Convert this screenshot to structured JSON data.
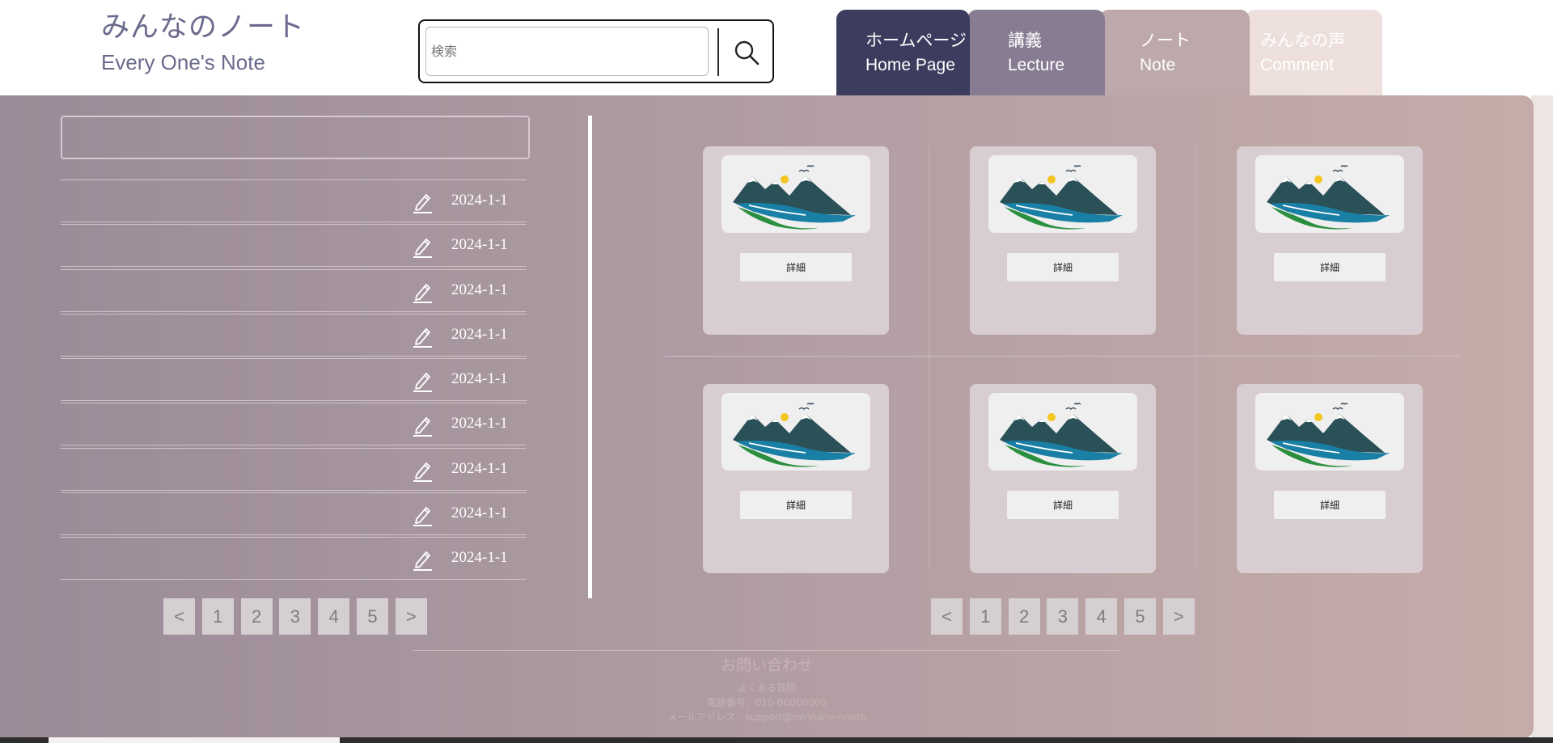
{
  "header": {
    "logo_jp": "みんなのノート",
    "logo_en": "Every One's Note",
    "search_placeholder": "検索",
    "search_icon": "magnifier-icon"
  },
  "nav": {
    "tabs": [
      {
        "jp": "ホームページ",
        "en": "Home Page"
      },
      {
        "jp": "講義",
        "en": "Lecture"
      },
      {
        "jp": "ノート",
        "en": "Note"
      },
      {
        "jp": "みんなの声",
        "en": "Comment"
      }
    ],
    "active": "Note"
  },
  "left_list": {
    "edit_icon": "pencil-icon",
    "items": [
      {
        "date": "2024-1-1"
      },
      {
        "date": "2024-1-1"
      },
      {
        "date": "2024-1-1"
      },
      {
        "date": "2024-1-1"
      },
      {
        "date": "2024-1-1"
      },
      {
        "date": "2024-1-1"
      },
      {
        "date": "2024-1-1"
      },
      {
        "date": "2024-1-1"
      },
      {
        "date": "2024-1-1"
      }
    ],
    "pagination": [
      "<",
      "1",
      "2",
      "3",
      "4",
      "5",
      ">"
    ]
  },
  "notes_grid": {
    "cards": [
      {
        "button": "詳細",
        "image": "mountain-lake-logo"
      },
      {
        "button": "詳細",
        "image": "mountain-lake-logo"
      },
      {
        "button": "詳細",
        "image": "mountain-lake-logo"
      },
      {
        "button": "詳細",
        "image": "mountain-lake-logo"
      },
      {
        "button": "詳細",
        "image": "mountain-lake-logo"
      },
      {
        "button": "詳細",
        "image": "mountain-lake-logo"
      }
    ],
    "pagination": [
      "<",
      "1",
      "2",
      "3",
      "4",
      "5",
      ">"
    ]
  },
  "footer": {
    "title": "お問い合わせ",
    "faq": "よくある質問",
    "phone": "電話番号：010-00000000",
    "email": "メールアドレス：support@minnano-nooto"
  },
  "colors": {
    "home_tab": "#3c3d5e",
    "lecture_tab": "#877c92",
    "note_tab": "#bda8ac",
    "comment_tab": "#ede0dc",
    "panel_start": "#9a8b98",
    "panel_end": "#c6aca9"
  }
}
